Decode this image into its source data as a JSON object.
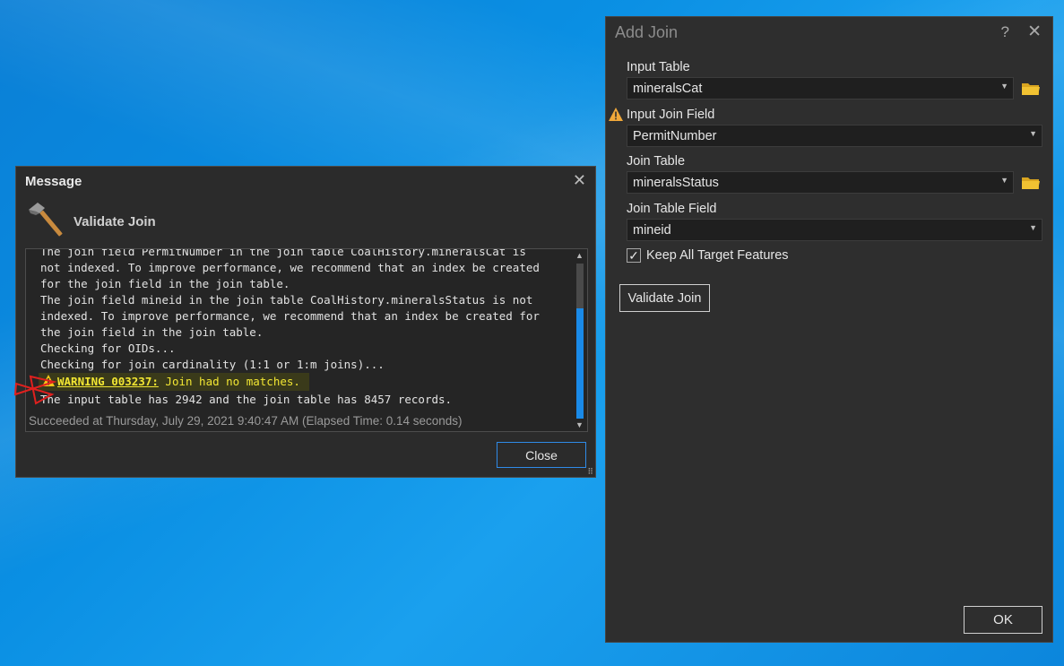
{
  "message_dialog": {
    "title": "Message",
    "close_glyph": "✕",
    "icon": "hammer-icon",
    "heading": "Validate Join",
    "lines": [
      "The join field PermitNumber in the join table CoalHistory.mineralsCat is",
      "not indexed. To improve performance, we recommend that an index be created",
      "for the join field in the join table.",
      "The join field mineid in the join table CoalHistory.mineralsStatus is not",
      "indexed. To improve performance, we recommend that an index be created for",
      "the join field in the join table.",
      "Checking for OIDs...",
      "Checking for join cardinality (1:1 or 1:m joins)..."
    ],
    "warning": {
      "code": "WARNING 003237:",
      "text": " Join had no matches.",
      "color": "#f2e633"
    },
    "records_line": "The input table has 2942 and the join table has 8457 records.",
    "succeeded": "Succeeded at Thursday, July 29, 2021 9:40:47 AM (Elapsed Time: 0.14 seconds)",
    "close_label": "Close"
  },
  "add_join": {
    "title": "Add Join",
    "help_glyph": "?",
    "close_glyph": "✕",
    "input_table": {
      "label": "Input Table",
      "value": "mineralsCat"
    },
    "input_join_field": {
      "label": "Input Join Field",
      "value": "PermitNumber",
      "status": "warning"
    },
    "join_table": {
      "label": "Join Table",
      "value": "mineralsStatus"
    },
    "join_table_field": {
      "label": "Join Table Field",
      "value": "mineid"
    },
    "keep_all": {
      "label": "Keep All Target Features",
      "checked": true,
      "glyph": "✓"
    },
    "validate_label": "Validate Join",
    "ok_label": "OK"
  },
  "colors": {
    "accent": "#1a8ae8",
    "warning": "#f2e633",
    "dialog_bg": "#2b2b2b"
  }
}
